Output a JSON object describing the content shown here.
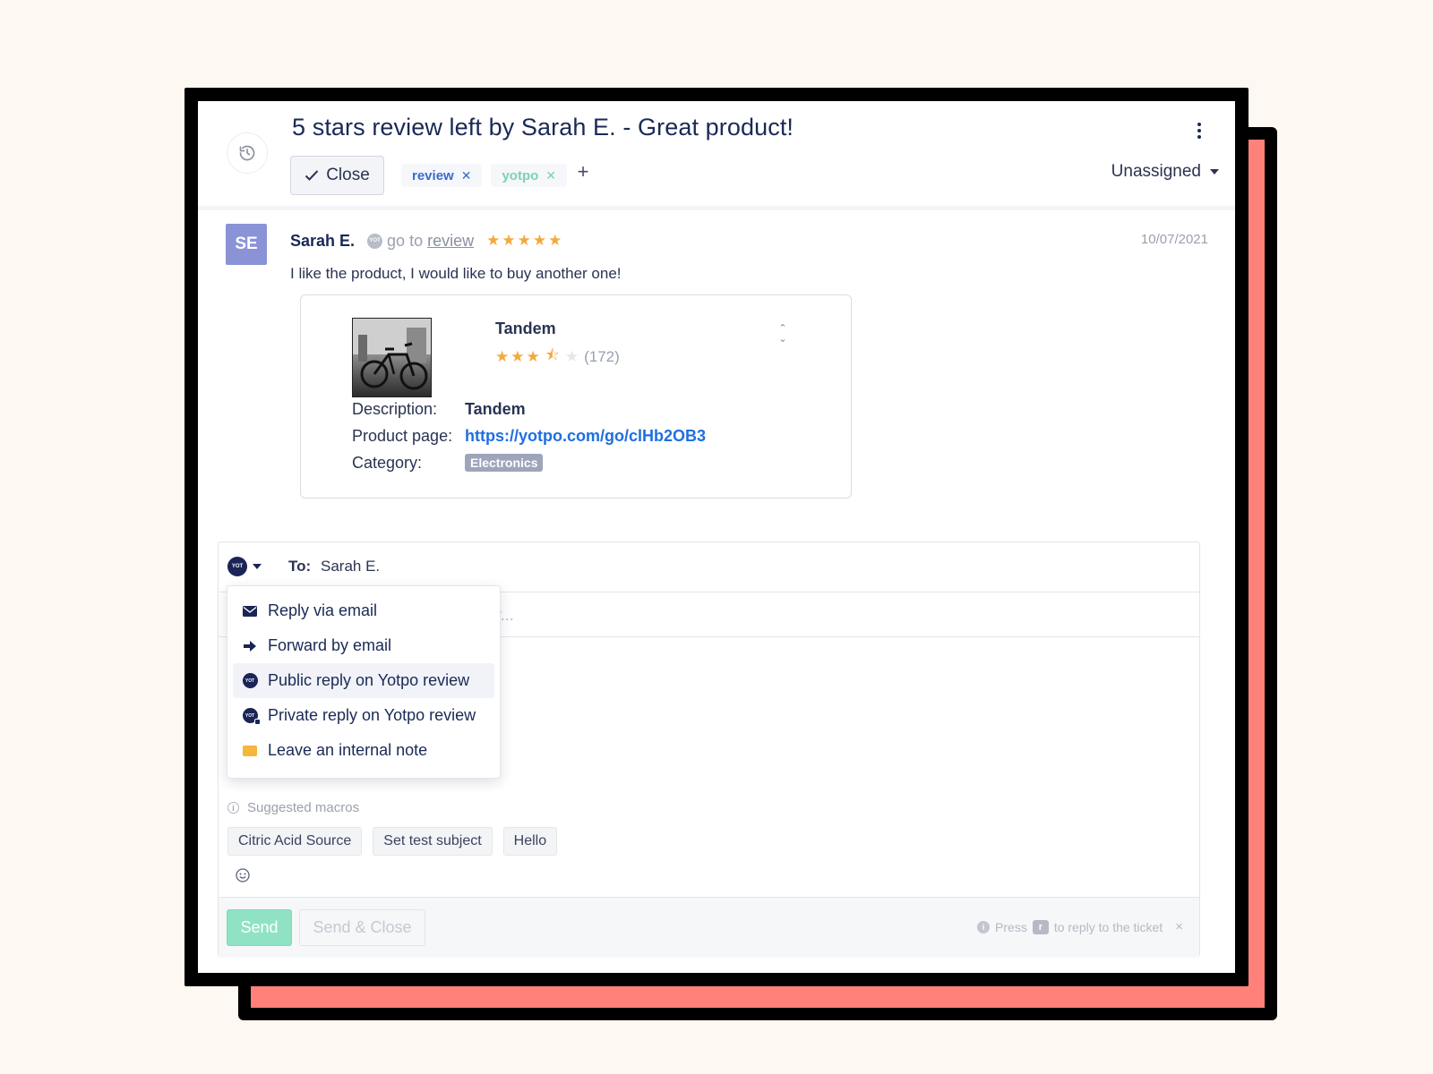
{
  "ticket": {
    "title": "5 stars review left by Sarah E. - Great product!",
    "close_label": "Close",
    "tags": [
      {
        "label": "review",
        "color": "#3a6bd0"
      },
      {
        "label": "yotpo",
        "color": "#79d3b3"
      }
    ],
    "add_tag_label": "+",
    "assignee": "Unassigned"
  },
  "message": {
    "avatar_initials": "SE",
    "avatar_color": "#8a93d6",
    "sender": "Sarah E.",
    "goto_prefix": "go to",
    "goto_link": "review",
    "stars": "★★★★★",
    "rating": 5,
    "date": "10/07/2021",
    "body": "I like the product, I would like to buy another one!"
  },
  "product": {
    "name": "Tandem",
    "stars_full": "★★★",
    "star_half": "⯪",
    "star_empty": "★",
    "rating": 3.5,
    "review_count": "(172)",
    "description_label": "Description:",
    "description_value": "Tandem",
    "page_label": "Product page:",
    "page_value": "https://yotpo.com/go/clHb2OB3",
    "category_label": "Category:",
    "category_value": "Electronics"
  },
  "composer": {
    "to_label": "To:",
    "to_name": "Sarah E.",
    "search_placeholder": "Search macros by name, tags or body...",
    "channel_menu": [
      {
        "label": "Reply via email",
        "icon": "envelope-icon"
      },
      {
        "label": "Forward by email",
        "icon": "forward-arrow-icon"
      },
      {
        "label": "Public reply on Yotpo review",
        "icon": "yotpo-icon",
        "active": true
      },
      {
        "label": "Private reply on Yotpo review",
        "icon": "yotpo-private-icon"
      },
      {
        "label": "Leave an internal note",
        "icon": "note-icon"
      }
    ],
    "macros_heading": "Suggested macros",
    "macros": [
      "Citric Acid Source",
      "Set test subject",
      "Hello"
    ],
    "send_label": "Send",
    "send_close_label": "Send & Close",
    "hint_prefix": "Press",
    "hint_key": "r",
    "hint_suffix": "to reply to the ticket",
    "hint_close": "×"
  },
  "colors": {
    "accent_navy": "#1a2a56",
    "link_blue": "#1f6fe0",
    "star_orange": "#f3a93e",
    "send_green": "#8fe3c4",
    "frame_coral": "#ff817a"
  }
}
